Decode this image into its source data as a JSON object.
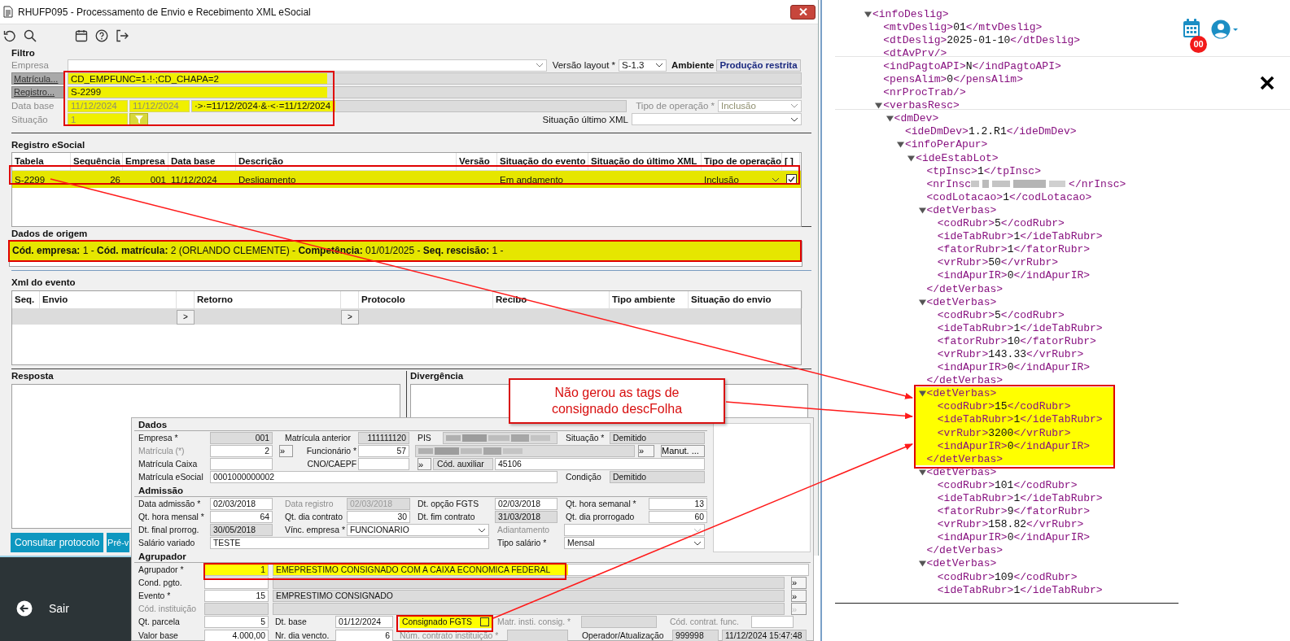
{
  "window": {
    "title": "RHUFP095 - Processamento de Envio e Recebimento XML eSocial"
  },
  "filter": {
    "title": "Filtro",
    "empresa": {
      "label": "Empresa"
    },
    "versao_layout": {
      "label": "Versão layout *",
      "value": "S-1.3"
    },
    "ambiente": {
      "label": "Ambiente",
      "value": "Produção restrita"
    },
    "matricula": {
      "label": "Matrícula...",
      "value": "CD_EMPFUNC=1·!·;CD_CHAPA=2",
      "highlighted": true
    },
    "registro": {
      "label": "Registro...",
      "value": "S-2299",
      "highlighted": true
    },
    "data_base": {
      "label": "Data base",
      "from": "11/12/2024",
      "to": "11/12/2024",
      "expression": "·>·=11/12/2024·&·<·=11/12/2024",
      "highlighted": true
    },
    "tipo_operacao": {
      "label": "Tipo de operação *",
      "value": "Inclusão",
      "disabled": true
    },
    "situacao": {
      "label": "Situação",
      "value": "1",
      "highlighted": true
    },
    "situacao_ultimo_xml": {
      "label": "Situação último XML"
    }
  },
  "registro": {
    "title": "Registro eSocial",
    "columns": [
      "Tabela",
      "Sequência",
      "Empresa",
      "Data base",
      "Descrição",
      "Versão",
      "Situação do evento",
      "Situação do último XML",
      "Tipo de operação",
      "[ ]"
    ],
    "rows": [
      {
        "tabela": "S-2299",
        "sequencia": "26",
        "empresa": "001",
        "data_base": "11/12/2024",
        "descricao": "Desligamento",
        "situacao_evento": "Em andamento",
        "tipo_operacao": "Inclusão",
        "checked": true,
        "highlighted": true
      }
    ]
  },
  "dados_origem": {
    "title": "Dados de origem",
    "text": "**Cód. empresa:** 1 - **Cód. matrícula:** 2 (ORLANDO CLEMENTE) - **Competência:** 01/01/2025 - **Seq. rescisão:** 1 -",
    "highlighted": true
  },
  "xml_evento": {
    "title": "Xml do evento",
    "columns": [
      "Seq.",
      "Envio",
      "Retorno",
      "Protocolo",
      "Recibo",
      "Tipo ambiente",
      "Situação do envio"
    ],
    "row_buttons": [
      ">",
      ">"
    ]
  },
  "resposta": {
    "title": "Resposta"
  },
  "divergencia": {
    "title": "Divergência"
  },
  "buttons": [
    "Consultar protocolo",
    "Pré-v"
  ],
  "sidebar": {
    "exit_label": "Sair"
  },
  "callout": {
    "text": "Não gerou as tags de consignado descFolha"
  },
  "cadastro": {
    "sections": [
      {
        "title": "Dados",
        "lines": [
          {
            "controls": [
              {
                "kind": "label",
                "text": "Empresa *",
                "disabled": false
              },
              {
                "kind": "field",
                "value": "001",
                "readonly": true
              },
              {
                "kind": "label",
                "text": "Matrícula anterior",
                "disabled": false
              },
              {
                "kind": "field",
                "value": "111111120",
                "readonly": true
              },
              {
                "kind": "label",
                "text": "PIS",
                "disabled": false
              },
              {
                "kind": "blurred",
                "readonly": true
              },
              {
                "kind": "label",
                "text": "Situação *",
                "disabled": false
              },
              {
                "kind": "field",
                "value": "Demitido",
                "readonly": true
              }
            ]
          },
          {
            "controls": [
              {
                "kind": "label",
                "text": "Matrícula (*)",
                "disabled": true
              },
              {
                "kind": "field",
                "value": "2",
                "readonly": false
              },
              {
                "kind": "button",
                "text": "»",
                "disabled": false
              },
              {
                "kind": "label",
                "text": "Funcionário *",
                "disabled": false
              },
              {
                "kind": "field",
                "value": "57",
                "readonly": false
              },
              {
                "kind": "blurred",
                "readonly": true
              },
              {
                "kind": "button",
                "text": "»",
                "disabled": false
              },
              {
                "kind": "button",
                "text": "Manut. ...",
                "disabled": false
              }
            ]
          },
          {
            "controls": [
              {
                "kind": "label",
                "text": "Matrícula Caixa",
                "disabled": false
              },
              {
                "kind": "field",
                "readonly": false
              },
              {
                "kind": "label",
                "text": "CNO/CAEPF",
                "disabled": false
              },
              {
                "kind": "field",
                "readonly": false
              },
              {
                "kind": "button",
                "text": "»",
                "disabled": false
              },
              {
                "kind": "caption",
                "text": "Cód. auxiliar"
              },
              {
                "kind": "field",
                "value": "45106",
                "readonly": false
              }
            ]
          },
          {
            "controls": [
              {
                "kind": "label",
                "text": "Matrícula eSocial",
                "disabled": false
              },
              {
                "kind": "field",
                "value": "0001000000002",
                "readonly": false
              },
              {
                "kind": "label",
                "text": "Condição",
                "disabled": false
              },
              {
                "kind": "field",
                "value": "Demitido",
                "readonly": true
              }
            ]
          }
        ]
      },
      {
        "title": "Admissão",
        "lines": [
          {
            "controls": [
              {
                "kind": "label",
                "text": "Data admissão *",
                "disabled": false
              },
              {
                "kind": "field",
                "value": "02/03/2018",
                "readonly": false
              },
              {
                "kind": "label",
                "text": "Data registro",
                "disabled": true
              },
              {
                "kind": "field",
                "value": "02/03/2018",
                "readonly": true,
                "disabled": true
              },
              {
                "kind": "label",
                "text": "Dt. opção FGTS",
                "disabled": false
              },
              {
                "kind": "field",
                "value": "02/03/2018",
                "readonly": false
              },
              {
                "kind": "label",
                "text": "Qt. hora semanal *",
                "disabled": false
              },
              {
                "kind": "field",
                "value": "13",
                "readonly": false
              }
            ]
          },
          {
            "controls": [
              {
                "kind": "label",
                "text": "Qt. hora mensal *",
                "disabled": false
              },
              {
                "kind": "field",
                "value": "64",
                "readonly": false
              },
              {
                "kind": "label",
                "text": "Qt. dia contrato",
                "disabled": false
              },
              {
                "kind": "field",
                "value": "30",
                "readonly": false
              },
              {
                "kind": "label",
                "text": "Dt. fim contrato",
                "disabled": false
              },
              {
                "kind": "field",
                "value": "31/03/2018",
                "readonly": true
              },
              {
                "kind": "label",
                "text": "Qt. dia prorrogado",
                "disabled": false
              },
              {
                "kind": "field",
                "value": "60",
                "readonly": false
              }
            ]
          },
          {
            "controls": [
              {
                "kind": "label",
                "text": "Dt. final prorrog.",
                "disabled": false
              },
              {
                "kind": "field",
                "value": "30/05/2018",
                "readonly": true
              },
              {
                "kind": "label",
                "text": "Vínc. empresa *",
                "disabled": false
              },
              {
                "kind": "select",
                "value": "FUNCIONARIO",
                "disabled": false
              },
              {
                "kind": "label",
                "text": "Adiantamento",
                "disabled": true
              },
              {
                "kind": "select",
                "disabled": true
              }
            ]
          },
          {
            "controls": [
              {
                "kind": "label",
                "text": "Salário variado",
                "disabled": false
              },
              {
                "kind": "field",
                "value": "TESTE",
                "readonly": false
              },
              {
                "kind": "label",
                "text": "Tipo salário *",
                "disabled": false
              },
              {
                "kind": "select",
                "value": "Mensal",
                "disabled": false
              }
            ]
          }
        ]
      },
      {
        "title": "Agrupador",
        "lines": [
          {
            "controls": [
              {
                "kind": "label",
                "text": "Agrupador *",
                "disabled": false
              },
              {
                "kind": "field",
                "value": "1",
                "highlighted": true
              },
              {
                "kind": "field",
                "value": "EMEPRESTIMO CONSIGNADO COM A CAIXA ECONOMICA FEDERAL",
                "highlighted": true
              }
            ]
          },
          {
            "controls": [
              {
                "kind": "label",
                "text": "Cond. pgto.",
                "disabled": false
              },
              {
                "kind": "field",
                "readonly": false
              },
              {
                "kind": "field",
                "readonly": true
              },
              {
                "kind": "button",
                "text": "»",
                "disabled": false
              }
            ]
          },
          {
            "controls": [
              {
                "kind": "label",
                "text": "Evento *",
                "disabled": false
              },
              {
                "kind": "field",
                "value": "15",
                "readonly": false
              },
              {
                "kind": "field",
                "value": "EMPRESTIMO CONSIGNADO",
                "readonly": true
              },
              {
                "kind": "button",
                "text": "»",
                "disabled": false
              }
            ]
          },
          {
            "controls": [
              {
                "kind": "label",
                "text": "Cód. instituição",
                "disabled": true
              },
              {
                "kind": "field",
                "readonly": true
              },
              {
                "kind": "field",
                "readonly": true
              },
              {
                "kind": "button",
                "text": "»",
                "disabled": true
              }
            ]
          },
          {
            "controls": [
              {
                "kind": "label",
                "text": "Qt. parcela",
                "disabled": false
              },
              {
                "kind": "field",
                "value": "5",
                "readonly": false
              },
              {
                "kind": "label",
                "text": "Dt. base",
                "disabled": false
              },
              {
                "kind": "field",
                "value": "01/12/2024",
                "readonly": false
              },
              {
                "kind": "checkbox",
                "text": "Consignado FGTS",
                "checked": false,
                "highlighted": true
              },
              {
                "kind": "label",
                "text": "Matr. insti. consig. *",
                "disabled": true
              },
              {
                "kind": "field",
                "readonly": true
              },
              {
                "kind": "label",
                "text": "Cód. contrat. func.",
                "disabled": true
              },
              {
                "kind": "field",
                "readonly": false
              }
            ]
          },
          {
            "controls": [
              {
                "kind": "label",
                "text": "Valor base",
                "disabled": false
              },
              {
                "kind": "field",
                "value": "4.000,00",
                "readonly": false
              },
              {
                "kind": "label",
                "text": "Nr. dia vencto.",
                "disabled": false
              },
              {
                "kind": "field",
                "value": "6",
                "readonly": false
              },
              {
                "kind": "label",
                "text": "Núm. contrato instituição *",
                "disabled": true
              },
              {
                "kind": "field",
                "readonly": true
              },
              {
                "kind": "label",
                "text": "Operador/Atualização",
                "disabled": false
              },
              {
                "kind": "field",
                "value": "999998",
                "readonly": true
              },
              {
                "kind": "field",
                "value": "11/12/2024 15:47:48",
                "readonly": true
              }
            ]
          }
        ]
      }
    ]
  },
  "page_header": {
    "badge": "00"
  },
  "xml": {
    "nodes": [
      {
        "open": "<infoDeslig>",
        "expanded": true,
        "highlighted": false,
        "children": [
          {
            "open": "<mtvDeslig>",
            "value": "01",
            "close": "</mtvDeslig>"
          },
          {
            "open": "<dtDeslig>",
            "value": "2025-01-10",
            "close": "</dtDeslig>"
          },
          {
            "open": "<dtAvPrv/>"
          },
          {
            "open": "<indPagtoAPI>",
            "value": "N",
            "close": "</indPagtoAPI>"
          },
          {
            "open": "<pensAlim>",
            "value": "0",
            "close": "</pensAlim>"
          },
          {
            "open": "<nrProcTrab/>"
          },
          {
            "open": "<verbasResc>",
            "expanded": true,
            "highlighted": false,
            "children": [
              {
                "open": "<dmDev>",
                "expanded": true,
                "highlighted": false,
                "children": [
                  {
                    "open": "<ideDmDev>",
                    "value": "1.2.R1",
                    "close": "</ideDmDev>"
                  },
                  {
                    "open": "<infoPerApur>",
                    "expanded": true,
                    "highlighted": false,
                    "children": [
                      {
                        "open": "<ideEstabLot>",
                        "expanded": true,
                        "highlighted": false,
                        "children": [
                          {
                            "open": "<tpInsc>",
                            "value": "1",
                            "close": "</tpInsc>"
                          },
                          {
                            "open": "<nrInsc",
                            "redacted": true,
                            "close": "</nrInsc>"
                          },
                          {
                            "open": "<codLotacao>",
                            "value": "1",
                            "close": "</codLotacao>"
                          },
                          {
                            "open": "<detVerbas>",
                            "expanded": true,
                            "highlighted": false,
                            "close": "</detVerbas>",
                            "children": [
                              {
                                "open": "<codRubr>",
                                "value": "5",
                                "close": "</codRubr>"
                              },
                              {
                                "open": "<ideTabRubr>",
                                "value": "1",
                                "close": "</ideTabRubr>"
                              },
                              {
                                "open": "<fatorRubr>",
                                "value": "1",
                                "close": "</fatorRubr>"
                              },
                              {
                                "open": "<vrRubr>",
                                "value": "50",
                                "close": "</vrRubr>"
                              },
                              {
                                "open": "<indApurIR>",
                                "value": "0",
                                "close": "</indApurIR>"
                              }
                            ]
                          },
                          {
                            "open": "<detVerbas>",
                            "expanded": true,
                            "highlighted": false,
                            "close": "</detVerbas>",
                            "children": [
                              {
                                "open": "<codRubr>",
                                "value": "5",
                                "close": "</codRubr>"
                              },
                              {
                                "open": "<ideTabRubr>",
                                "value": "1",
                                "close": "</ideTabRubr>"
                              },
                              {
                                "open": "<fatorRubr>",
                                "value": "10",
                                "close": "</fatorRubr>"
                              },
                              {
                                "open": "<vrRubr>",
                                "value": "143.33",
                                "close": "</vrRubr>"
                              },
                              {
                                "open": "<indApurIR>",
                                "value": "0",
                                "close": "</indApurIR>"
                              }
                            ]
                          },
                          {
                            "open": "<detVerbas>",
                            "expanded": true,
                            "highlighted": true,
                            "close": "</detVerbas>",
                            "children": [
                              {
                                "open": "<codRubr>",
                                "value": "15",
                                "close": "</codRubr>"
                              },
                              {
                                "open": "<ideTabRubr>",
                                "value": "1",
                                "close": "</ideTabRubr>"
                              },
                              {
                                "open": "<vrRubr>",
                                "value": "3200",
                                "close": "</vrRubr>"
                              },
                              {
                                "open": "<indApurIR>",
                                "value": "0",
                                "close": "</indApurIR>"
                              }
                            ]
                          },
                          {
                            "open": "<detVerbas>",
                            "expanded": true,
                            "highlighted": false,
                            "close": "</detVerbas>",
                            "children": [
                              {
                                "open": "<codRubr>",
                                "value": "101",
                                "close": "</codRubr>"
                              },
                              {
                                "open": "<ideTabRubr>",
                                "value": "1",
                                "close": "</ideTabRubr>"
                              },
                              {
                                "open": "<fatorRubr>",
                                "value": "9",
                                "close": "</fatorRubr>"
                              },
                              {
                                "open": "<vrRubr>",
                                "value": "158.82",
                                "close": "</vrRubr>"
                              },
                              {
                                "open": "<indApurIR>",
                                "value": "0",
                                "close": "</indApurIR>"
                              }
                            ]
                          },
                          {
                            "open": "<detVerbas>",
                            "expanded": true,
                            "highlighted": false,
                            "children": [
                              {
                                "open": "<codRubr>",
                                "value": "109",
                                "close": "</codRubr>"
                              },
                              {
                                "open": "<ideTabRubr>",
                                "value": "1",
                                "close": "</ideTabRubr>"
                              }
                            ]
                          }
                        ]
                      }
                    ]
                  }
                ]
              }
            ]
          }
        ]
      }
    ]
  }
}
